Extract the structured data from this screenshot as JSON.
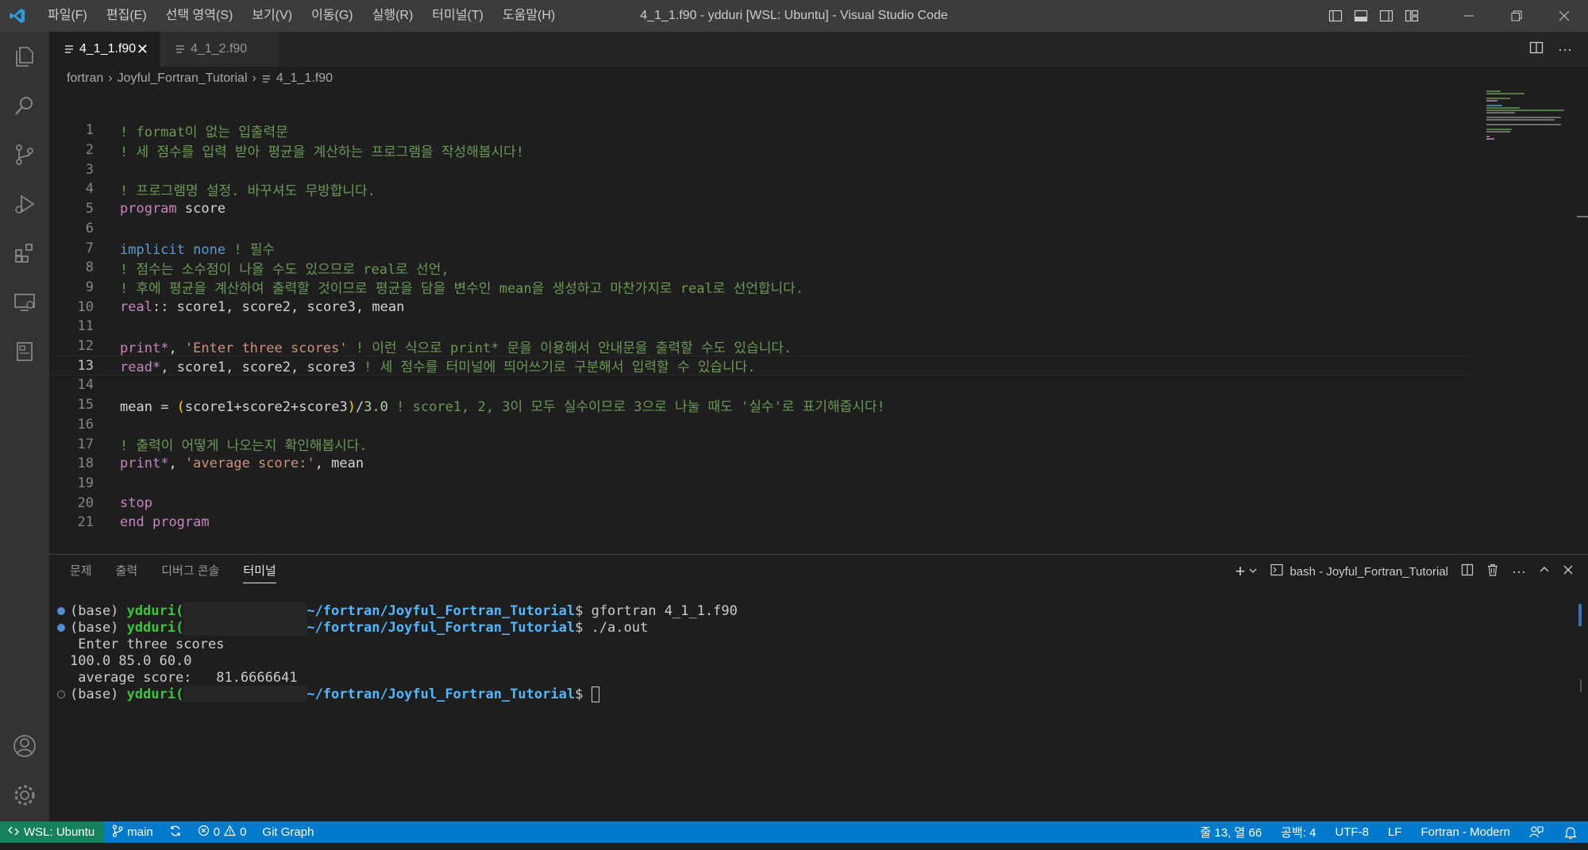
{
  "titlebar": {
    "menu": [
      "파일(F)",
      "편집(E)",
      "선택 영역(S)",
      "보기(V)",
      "이동(G)",
      "실행(R)",
      "터미널(T)",
      "도움말(H)"
    ],
    "title": "4_1_1.f90 - ydduri [WSL: Ubuntu] - Visual Studio Code"
  },
  "tabs": [
    {
      "label": "4_1_1.f90",
      "active": true
    },
    {
      "label": "4_1_2.f90",
      "active": false
    }
  ],
  "breadcrumb": [
    "fortran",
    "Joyful_Fortran_Tutorial",
    "4_1_1.f90"
  ],
  "editor": {
    "current_line": 13,
    "lines": [
      {
        "n": "1",
        "t": "! format이 없는 입출력문"
      },
      {
        "n": "2",
        "t": "! 세 점수를 입력 받아 평균을 계산하는 프로그램을 작성해봅시다!"
      },
      {
        "n": "3",
        "t": ""
      },
      {
        "n": "4",
        "t": "! 프로그램명 설정. 바꾸셔도 무방합니다."
      },
      {
        "n": "5",
        "t": "program score"
      },
      {
        "n": "6",
        "t": ""
      },
      {
        "n": "7",
        "t": "implicit none ! 필수"
      },
      {
        "n": "8",
        "t": "! 점수는 소수점이 나올 수도 있으므로 real로 선언,"
      },
      {
        "n": "9",
        "t": "! 후에 평균을 계산하여 출력할 것이므로 평균을 담을 변수인 mean을 생성하고 마찬가지로 real로 선언합니다."
      },
      {
        "n": "10",
        "t": "real:: score1, score2, score3, mean"
      },
      {
        "n": "11",
        "t": ""
      },
      {
        "n": "12",
        "t": "print*, 'Enter three scores' ! 이런 식으로 print* 문을 이용해서 안내문을 출력할 수도 있습니다."
      },
      {
        "n": "13",
        "t": "read*, score1, score2, score3 ! 세 점수를 터미널에 띄어쓰기로 구분해서 입력할 수 있습니다."
      },
      {
        "n": "14",
        "t": ""
      },
      {
        "n": "15",
        "t": "mean = (score1+score2+score3)/3.0 ! score1, 2, 3이 모두 실수이므로 3으로 나눌 때도 '실수'로 표기해줍시다!"
      },
      {
        "n": "16",
        "t": ""
      },
      {
        "n": "17",
        "t": "! 출력이 어떻게 나오는지 확인해봅시다."
      },
      {
        "n": "18",
        "t": "print*, 'average score:', mean"
      },
      {
        "n": "19",
        "t": ""
      },
      {
        "n": "20",
        "t": "stop"
      },
      {
        "n": "21",
        "t": "end program"
      }
    ]
  },
  "panel": {
    "tabs": [
      "문제",
      "출력",
      "디버그 콘솔",
      "터미널"
    ],
    "active_tab": "터미널",
    "terminal_name": "bash - Joyful_Fortran_Tutorial"
  },
  "terminal": {
    "env": "(base)",
    "user": "ydduri(",
    "path": "~/fortran/Joyful_Fortran_Tutorial",
    "cmd1": "gfortran 4_1_1.f90",
    "cmd2": "./a.out",
    "out1": " Enter three scores",
    "out2": "100.0 85.0 60.0",
    "out3": " average score:   81.6666641"
  },
  "statusbar": {
    "remote": "WSL: Ubuntu",
    "branch": "main",
    "errors": "0",
    "warnings": "0",
    "git_graph": "Git Graph",
    "position": "줄 13, 열 66",
    "spaces": "공백: 4",
    "encoding": "UTF-8",
    "eol": "LF",
    "language": "Fortran - Modern"
  },
  "colors": {
    "comment": "#6a9955",
    "keyword": "#c586c0",
    "statusbar": "#007acc",
    "remote": "#16825d"
  }
}
